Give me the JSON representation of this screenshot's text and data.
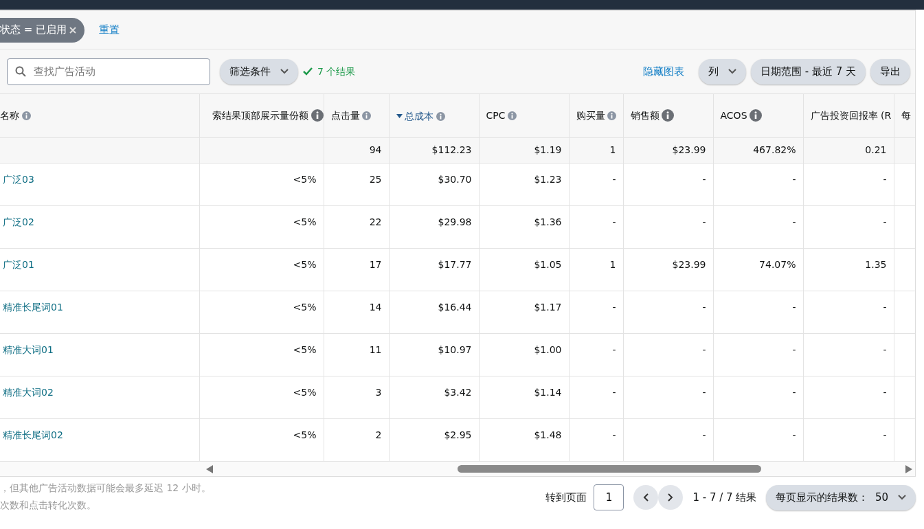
{
  "filter_chips": [
    {
      "label": "状态 = 已启用"
    }
  ],
  "reset_link": "重置",
  "search": {
    "placeholder": "查找广告活动"
  },
  "filter_button": "筛选条件",
  "result_count": "7 个结果",
  "hide_chart_link": "隐藏图表",
  "columns_button": "列",
  "date_range_button": "日期范围 - 最近 7 天",
  "export_button": "导出",
  "table": {
    "columns": [
      {
        "label": "名称",
        "kind": "light",
        "sorted": false
      },
      {
        "label": "索结果顶部展示量份额",
        "kind": "dark",
        "sorted": false
      },
      {
        "label": "点击量",
        "kind": "light",
        "sorted": false
      },
      {
        "label": "总成本",
        "kind": "light",
        "sorted": true
      },
      {
        "label": "CPC",
        "kind": "light",
        "sorted": false
      },
      {
        "label": "购买量",
        "kind": "light",
        "sorted": false
      },
      {
        "label": "销售额",
        "kind": "dark",
        "sorted": false
      },
      {
        "label": "ACOS",
        "kind": "dark",
        "sorted": false
      },
      {
        "label": "广告投资回报率 (R",
        "kind": "plain",
        "sorted": false
      },
      {
        "label": "每",
        "kind": "plain",
        "sorted": false
      }
    ],
    "totals": [
      "94",
      "$112.23",
      "$1.19",
      "1",
      "$23.99",
      "467.82%",
      "0.21"
    ],
    "rows": [
      {
        "cells": [
          "广泛03",
          "<5%",
          "25",
          "$30.70",
          "$1.23",
          "-",
          "-",
          "-",
          "-"
        ]
      },
      {
        "cells": [
          "广泛02",
          "<5%",
          "22",
          "$29.98",
          "$1.36",
          "-",
          "-",
          "-",
          "-"
        ]
      },
      {
        "cells": [
          "广泛01",
          "<5%",
          "17",
          "$17.77",
          "$1.05",
          "1",
          "$23.99",
          "74.07%",
          "1.35"
        ]
      },
      {
        "cells": [
          "精准长尾词01",
          "<5%",
          "14",
          "$16.44",
          "$1.17",
          "-",
          "-",
          "-",
          "-"
        ]
      },
      {
        "cells": [
          "精准大词01",
          "<5%",
          "11",
          "$10.97",
          "$1.00",
          "-",
          "-",
          "-",
          "-"
        ]
      },
      {
        "cells": [
          "精准大词02",
          "<5%",
          "3",
          "$3.42",
          "$1.14",
          "-",
          "-",
          "-",
          "-"
        ]
      },
      {
        "cells": [
          "精准长尾词02",
          "<5%",
          "2",
          "$2.95",
          "$1.48",
          "-",
          "-",
          "-",
          "-"
        ]
      }
    ]
  },
  "footer_notes": [
    "，但其他广告活动数据可能会最多延迟 12 小时。",
    "次数和点击转化次数。"
  ],
  "pagination": {
    "go_to_label": "转到页面",
    "page": "1",
    "range": "1 - 7 / 7 结果",
    "per_page": "每页显示的结果数：  50"
  }
}
